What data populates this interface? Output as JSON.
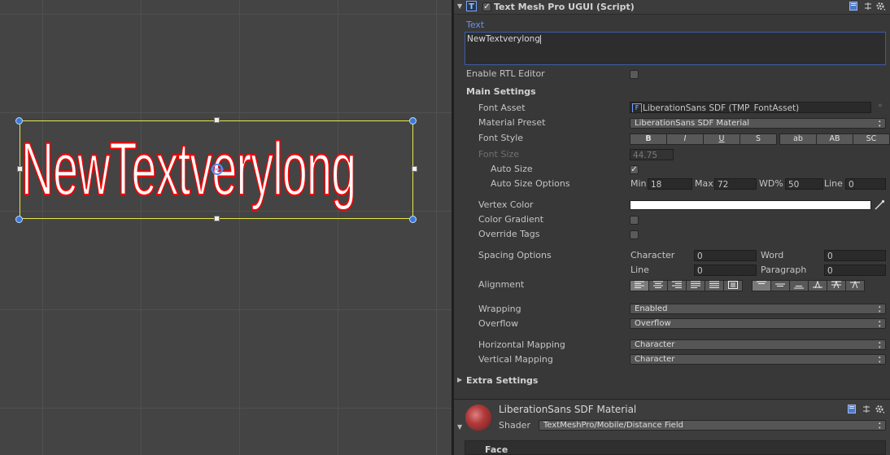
{
  "component": {
    "title": "Text Mesh Pro UGUI (Script)",
    "icon": "T",
    "enabled": true
  },
  "text_section": {
    "label": "Text",
    "value": "NewTextverylong"
  },
  "rtl": {
    "label": "Enable RTL Editor",
    "checked": false
  },
  "main_settings": {
    "header": "Main Settings",
    "font_asset": {
      "label": "Font Asset",
      "value": "LiberationSans SDF (TMP_FontAsset)"
    },
    "material_preset": {
      "label": "Material Preset",
      "value": "LiberationSans SDF Material"
    },
    "font_style": {
      "label": "Font Style",
      "buttons": [
        "B",
        "I",
        "U",
        "S",
        "ab",
        "AB",
        "SC"
      ]
    },
    "font_size": {
      "label": "Font Size",
      "value": "44.75"
    },
    "auto_size": {
      "label": "Auto Size",
      "checked": true
    },
    "auto_size_options": {
      "label": "Auto Size Options",
      "min_label": "Min",
      "min": "18",
      "max_label": "Max",
      "max": "72",
      "wd_label": "WD%",
      "wd": "50",
      "line_label": "Line",
      "line": "0"
    },
    "vertex_color": {
      "label": "Vertex Color",
      "color": "#ffffff"
    },
    "color_gradient": {
      "label": "Color Gradient",
      "checked": false
    },
    "override_tags": {
      "label": "Override Tags",
      "checked": false
    },
    "spacing": {
      "label": "Spacing Options",
      "character_label": "Character",
      "character": "0",
      "word_label": "Word",
      "word": "0",
      "line_label": "Line",
      "line": "0",
      "paragraph_label": "Paragraph",
      "paragraph": "0"
    },
    "alignment": {
      "label": "Alignment"
    },
    "wrapping": {
      "label": "Wrapping",
      "value": "Enabled"
    },
    "overflow": {
      "label": "Overflow",
      "value": "Overflow"
    },
    "horizontal_mapping": {
      "label": "Horizontal Mapping",
      "value": "Character"
    },
    "vertical_mapping": {
      "label": "Vertical Mapping",
      "value": "Character"
    }
  },
  "extra_settings": {
    "label": "Extra Settings"
  },
  "material": {
    "name": "LiberationSans SDF Material",
    "shader_label": "Shader",
    "shader": "TextMeshPro/Mobile/Distance Field",
    "face_label": "Face"
  },
  "scene": {
    "text": "NewTextverylong",
    "text_color": "#ffffff",
    "outline_color": "#ff0000"
  },
  "colors": {
    "accent": "#5b7fd6",
    "background": "#383838"
  }
}
